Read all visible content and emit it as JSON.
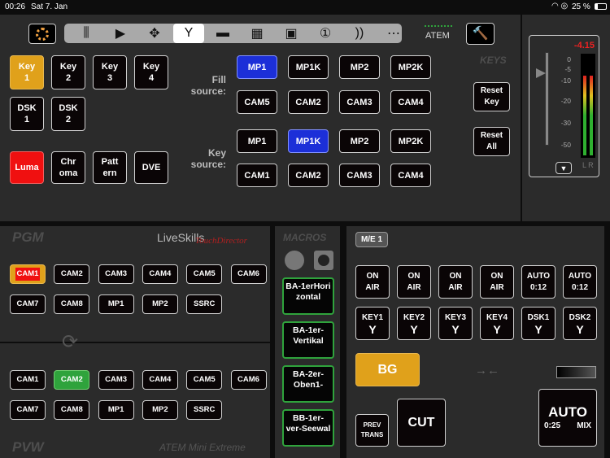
{
  "status": {
    "time": "00:26",
    "date": "Sat 7. Jan",
    "battery": "25 %"
  },
  "toolbar": {
    "items": [
      "mixer-icon",
      "play-icon",
      "move-icon",
      "keyer-icon",
      "monitor-icon",
      "multiview-icon",
      "pip-icon",
      "one-icon",
      "audio-icon",
      "more-icon"
    ],
    "active": "keyer-icon",
    "atem_label": "ATEM"
  },
  "keys": {
    "title": "KEYS",
    "key_buttons": [
      "Key\n1",
      "Key\n2",
      "Key\n3",
      "Key\n4"
    ],
    "dsk_buttons": [
      "DSK\n1",
      "DSK\n2"
    ],
    "type_buttons": [
      "Luma",
      "Chr\noma",
      "Patt\nern",
      "DVE"
    ],
    "fill_label": "Fill\nsource:",
    "key_label": "Key\nsource:",
    "fill_row1": [
      "MP1",
      "MP1K",
      "MP2",
      "MP2K"
    ],
    "fill_row2": [
      "CAM5",
      "CAM2",
      "CAM3",
      "CAM4"
    ],
    "key_row1": [
      "MP1",
      "MP1K",
      "MP2",
      "MP2K"
    ],
    "key_row2": [
      "CAM1",
      "CAM2",
      "CAM3",
      "CAM4"
    ],
    "reset_key": "Reset\nKey",
    "reset_all": "Reset\nAll",
    "colors": {
      "key_active": "#e0a11b",
      "luma_active": "#f01010",
      "source_selected": "#1c2fd8"
    }
  },
  "audio": {
    "level": "-4.15",
    "scale": [
      "0",
      "-5",
      "-10",
      "-20",
      "-30",
      "-50"
    ],
    "channels": "L R"
  },
  "pgm": {
    "title": "PGM",
    "brand": "LiveSkills",
    "brand_sub": "TouchDirector",
    "row1": [
      "CAM1",
      "CAM2",
      "CAM3",
      "CAM4",
      "CAM5",
      "CAM6"
    ],
    "row2": [
      "CAM7",
      "CAM8",
      "MP1",
      "MP2",
      "SSRC"
    ],
    "selected": "CAM1"
  },
  "pvw": {
    "title": "PVW",
    "device": "ATEM Mini Extreme",
    "row1": [
      "CAM1",
      "CAM2",
      "CAM3",
      "CAM4",
      "CAM5",
      "CAM6"
    ],
    "row2": [
      "CAM7",
      "CAM8",
      "MP1",
      "MP2",
      "SSRC"
    ],
    "selected": "CAM2",
    "selected_color": "#2fa33c"
  },
  "macros": {
    "title": "MACROS",
    "items": [
      "BA-1erHori\nzontal",
      "BA-1er-\nVertikal",
      "BA-2er-\nOben1-",
      "BB-1er-\nver-Seewal"
    ]
  },
  "me": {
    "label": "M/E 1",
    "on_air": [
      "ON\nAIR",
      "ON\nAIR",
      "ON\nAIR",
      "ON\nAIR",
      "AUTO\n0:12",
      "AUTO\n0:12"
    ],
    "keys": [
      "KEY1",
      "KEY2",
      "KEY3",
      "KEY4",
      "DSK1",
      "DSK2"
    ],
    "bg": "BG",
    "prev_trans": "PREV\nTRANS",
    "cut": "CUT",
    "auto": "AUTO",
    "auto_time": "0:25",
    "auto_type": "MIX"
  }
}
